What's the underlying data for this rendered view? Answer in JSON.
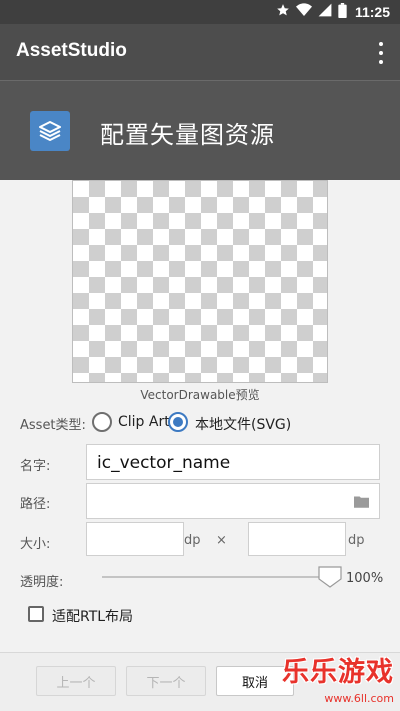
{
  "status_bar": {
    "time": "11:25",
    "icons": [
      "star-icon",
      "wifi-icon",
      "signal-icon",
      "battery-icon"
    ]
  },
  "app_bar": {
    "title": "AssetStudio",
    "menu_icon": "overflow-menu-icon"
  },
  "header": {
    "title": "配置矢量图资源",
    "icon": "layers-icon"
  },
  "preview": {
    "caption": "VectorDrawable预览"
  },
  "asset_type": {
    "label": "Asset类型:",
    "options": [
      {
        "label": "Clip Art",
        "selected": false
      },
      {
        "label": "本地文件(SVG)",
        "selected": true
      }
    ]
  },
  "name_field": {
    "label": "名字:",
    "value": "ic_vector_name"
  },
  "path_field": {
    "label": "路径:",
    "value": "",
    "icon": "folder-icon"
  },
  "size": {
    "label": "大小:",
    "width_value": "",
    "height_value": "",
    "unit": "dp",
    "separator": "×"
  },
  "opacity": {
    "label": "透明度:",
    "value_text": "100%",
    "value": 1.0
  },
  "rtl": {
    "label": "适配RTL布局",
    "checked": false
  },
  "buttons": {
    "prev": "上一个",
    "next": "下一个",
    "cancel": "取消"
  },
  "watermark": {
    "brand": "乐乐游戏",
    "site": "www.6ll.com"
  },
  "colors": {
    "status_bar": "#3f3f3f",
    "app_bar": "#4d4d4d",
    "header": "#555555",
    "accent": "#3d7ac2",
    "logo": "#4a86c6",
    "watermark": "#e8322b"
  }
}
